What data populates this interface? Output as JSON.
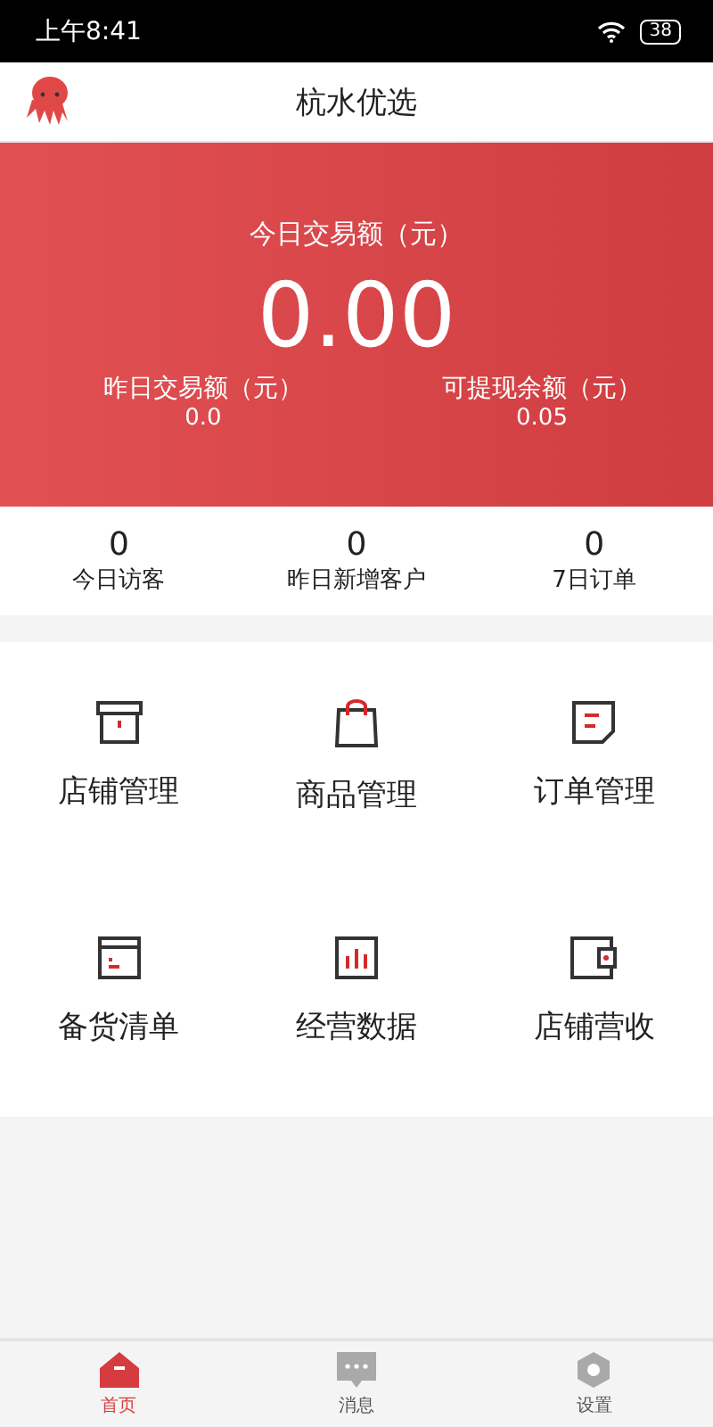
{
  "status_bar": {
    "time": "上午8:41",
    "battery": "38"
  },
  "header": {
    "title": "杭水优选"
  },
  "banner": {
    "today_label": "今日交易额（元）",
    "today_value": "0.00",
    "stats": [
      {
        "label": "昨日交易额（元）",
        "value": "0.0"
      },
      {
        "label": "可提现余额（元）",
        "value": "0.05"
      }
    ]
  },
  "counters": [
    {
      "value": "0",
      "label": "今日访客"
    },
    {
      "value": "0",
      "label": "昨日新增客户"
    },
    {
      "value": "0",
      "label": "7日订单"
    }
  ],
  "menu": [
    {
      "label": "店铺管理"
    },
    {
      "label": "商品管理"
    },
    {
      "label": "订单管理"
    },
    {
      "label": "备货清单"
    },
    {
      "label": "经营数据"
    },
    {
      "label": "店铺营收"
    }
  ],
  "tab_bar": [
    {
      "label": "首页",
      "selected": true
    },
    {
      "label": "消息",
      "selected": false
    },
    {
      "label": "设置",
      "selected": false
    }
  ]
}
